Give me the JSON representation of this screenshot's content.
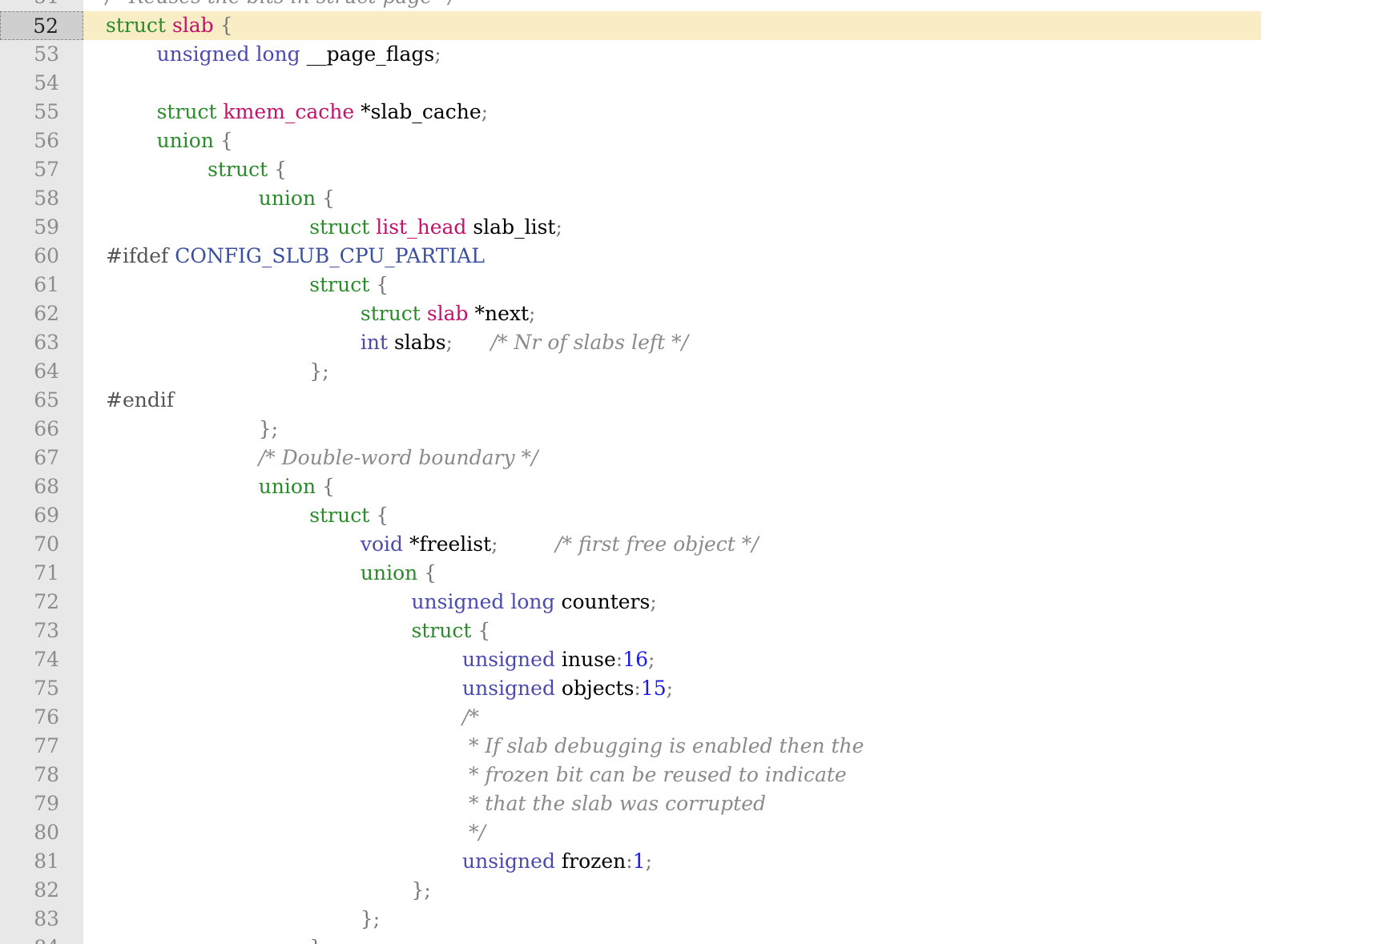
{
  "editor": {
    "current_line": 52,
    "lines": [
      {
        "n": 51,
        "tokens": [
          {
            "c": "comment",
            "t": "/* Reuses the bits in struct page */"
          }
        ]
      },
      {
        "n": 52,
        "tokens": [
          {
            "c": "kw",
            "t": "struct "
          },
          {
            "c": "name",
            "t": "slab"
          },
          {
            "c": "punct",
            "t": " {"
          }
        ]
      },
      {
        "n": 53,
        "tokens": [
          {
            "c": "ws",
            "t": "        "
          },
          {
            "c": "type",
            "t": "unsigned long "
          },
          {
            "c": "id",
            "t": "__page_flags"
          },
          {
            "c": "punct",
            "t": ";"
          }
        ]
      },
      {
        "n": 54,
        "tokens": []
      },
      {
        "n": 55,
        "tokens": [
          {
            "c": "ws",
            "t": "        "
          },
          {
            "c": "kw",
            "t": "struct "
          },
          {
            "c": "name",
            "t": "kmem_cache"
          },
          {
            "c": "id",
            "t": " *slab_cache"
          },
          {
            "c": "punct",
            "t": ";"
          }
        ]
      },
      {
        "n": 56,
        "tokens": [
          {
            "c": "ws",
            "t": "        "
          },
          {
            "c": "kw",
            "t": "union"
          },
          {
            "c": "punct",
            "t": " {"
          }
        ]
      },
      {
        "n": 57,
        "tokens": [
          {
            "c": "ws",
            "t": "                "
          },
          {
            "c": "kw",
            "t": "struct"
          },
          {
            "c": "punct",
            "t": " {"
          }
        ]
      },
      {
        "n": 58,
        "tokens": [
          {
            "c": "ws",
            "t": "                        "
          },
          {
            "c": "kw",
            "t": "union"
          },
          {
            "c": "punct",
            "t": " {"
          }
        ]
      },
      {
        "n": 59,
        "tokens": [
          {
            "c": "ws",
            "t": "                                "
          },
          {
            "c": "kw",
            "t": "struct "
          },
          {
            "c": "name",
            "t": "list_head"
          },
          {
            "c": "id",
            "t": " slab_list"
          },
          {
            "c": "punct",
            "t": ";"
          }
        ]
      },
      {
        "n": 60,
        "tokens": [
          {
            "c": "pre",
            "t": "#ifdef "
          },
          {
            "c": "macro",
            "t": "CONFIG_SLUB_CPU_PARTIAL"
          }
        ]
      },
      {
        "n": 61,
        "tokens": [
          {
            "c": "ws",
            "t": "                                "
          },
          {
            "c": "kw",
            "t": "struct"
          },
          {
            "c": "punct",
            "t": " {"
          }
        ]
      },
      {
        "n": 62,
        "tokens": [
          {
            "c": "ws",
            "t": "                                        "
          },
          {
            "c": "kw",
            "t": "struct "
          },
          {
            "c": "name",
            "t": "slab"
          },
          {
            "c": "id",
            "t": " *next"
          },
          {
            "c": "punct",
            "t": ";"
          }
        ]
      },
      {
        "n": 63,
        "tokens": [
          {
            "c": "ws",
            "t": "                                        "
          },
          {
            "c": "type",
            "t": "int "
          },
          {
            "c": "id",
            "t": "slabs"
          },
          {
            "c": "punct",
            "t": ";"
          },
          {
            "c": "ws",
            "t": "      "
          },
          {
            "c": "comment",
            "t": "/* Nr of slabs left */"
          }
        ]
      },
      {
        "n": 64,
        "tokens": [
          {
            "c": "ws",
            "t": "                                "
          },
          {
            "c": "punct",
            "t": "};"
          }
        ]
      },
      {
        "n": 65,
        "tokens": [
          {
            "c": "pre",
            "t": "#endif"
          }
        ]
      },
      {
        "n": 66,
        "tokens": [
          {
            "c": "ws",
            "t": "                        "
          },
          {
            "c": "punct",
            "t": "};"
          }
        ]
      },
      {
        "n": 67,
        "tokens": [
          {
            "c": "ws",
            "t": "                        "
          },
          {
            "c": "comment",
            "t": "/* Double-word boundary */"
          }
        ]
      },
      {
        "n": 68,
        "tokens": [
          {
            "c": "ws",
            "t": "                        "
          },
          {
            "c": "kw",
            "t": "union"
          },
          {
            "c": "punct",
            "t": " {"
          }
        ]
      },
      {
        "n": 69,
        "tokens": [
          {
            "c": "ws",
            "t": "                                "
          },
          {
            "c": "kw",
            "t": "struct"
          },
          {
            "c": "punct",
            "t": " {"
          }
        ]
      },
      {
        "n": 70,
        "tokens": [
          {
            "c": "ws",
            "t": "                                        "
          },
          {
            "c": "type",
            "t": "void "
          },
          {
            "c": "id",
            "t": "*freelist"
          },
          {
            "c": "punct",
            "t": ";"
          },
          {
            "c": "ws",
            "t": "         "
          },
          {
            "c": "comment",
            "t": "/* first free object */"
          }
        ]
      },
      {
        "n": 71,
        "tokens": [
          {
            "c": "ws",
            "t": "                                        "
          },
          {
            "c": "kw",
            "t": "union"
          },
          {
            "c": "punct",
            "t": " {"
          }
        ]
      },
      {
        "n": 72,
        "tokens": [
          {
            "c": "ws",
            "t": "                                                "
          },
          {
            "c": "type",
            "t": "unsigned long "
          },
          {
            "c": "id",
            "t": "counters"
          },
          {
            "c": "punct",
            "t": ";"
          }
        ]
      },
      {
        "n": 73,
        "tokens": [
          {
            "c": "ws",
            "t": "                                                "
          },
          {
            "c": "kw",
            "t": "struct"
          },
          {
            "c": "punct",
            "t": " {"
          }
        ]
      },
      {
        "n": 74,
        "tokens": [
          {
            "c": "ws",
            "t": "                                                        "
          },
          {
            "c": "type",
            "t": "unsigned "
          },
          {
            "c": "id",
            "t": "inuse"
          },
          {
            "c": "punct",
            "t": ":"
          },
          {
            "c": "num",
            "t": "16"
          },
          {
            "c": "punct",
            "t": ";"
          }
        ]
      },
      {
        "n": 75,
        "tokens": [
          {
            "c": "ws",
            "t": "                                                        "
          },
          {
            "c": "type",
            "t": "unsigned "
          },
          {
            "c": "id",
            "t": "objects"
          },
          {
            "c": "punct",
            "t": ":"
          },
          {
            "c": "num",
            "t": "15"
          },
          {
            "c": "punct",
            "t": ";"
          }
        ]
      },
      {
        "n": 76,
        "tokens": [
          {
            "c": "ws",
            "t": "                                                        "
          },
          {
            "c": "comment",
            "t": "/*"
          }
        ]
      },
      {
        "n": 77,
        "tokens": [
          {
            "c": "ws",
            "t": "                                                        "
          },
          {
            "c": "comment",
            "t": " * If slab debugging is enabled then the"
          }
        ]
      },
      {
        "n": 78,
        "tokens": [
          {
            "c": "ws",
            "t": "                                                        "
          },
          {
            "c": "comment",
            "t": " * frozen bit can be reused to indicate"
          }
        ]
      },
      {
        "n": 79,
        "tokens": [
          {
            "c": "ws",
            "t": "                                                        "
          },
          {
            "c": "comment",
            "t": " * that the slab was corrupted"
          }
        ]
      },
      {
        "n": 80,
        "tokens": [
          {
            "c": "ws",
            "t": "                                                        "
          },
          {
            "c": "comment",
            "t": " */"
          }
        ]
      },
      {
        "n": 81,
        "tokens": [
          {
            "c": "ws",
            "t": "                                                        "
          },
          {
            "c": "type",
            "t": "unsigned "
          },
          {
            "c": "id",
            "t": "frozen"
          },
          {
            "c": "punct",
            "t": ":"
          },
          {
            "c": "num",
            "t": "1"
          },
          {
            "c": "punct",
            "t": ";"
          }
        ]
      },
      {
        "n": 82,
        "tokens": [
          {
            "c": "ws",
            "t": "                                                "
          },
          {
            "c": "punct",
            "t": "};"
          }
        ]
      },
      {
        "n": 83,
        "tokens": [
          {
            "c": "ws",
            "t": "                                        "
          },
          {
            "c": "punct",
            "t": "};"
          }
        ]
      },
      {
        "n": 84,
        "tokens": [
          {
            "c": "ws",
            "t": "                                "
          },
          {
            "c": "punct",
            "t": "};"
          }
        ]
      }
    ]
  }
}
